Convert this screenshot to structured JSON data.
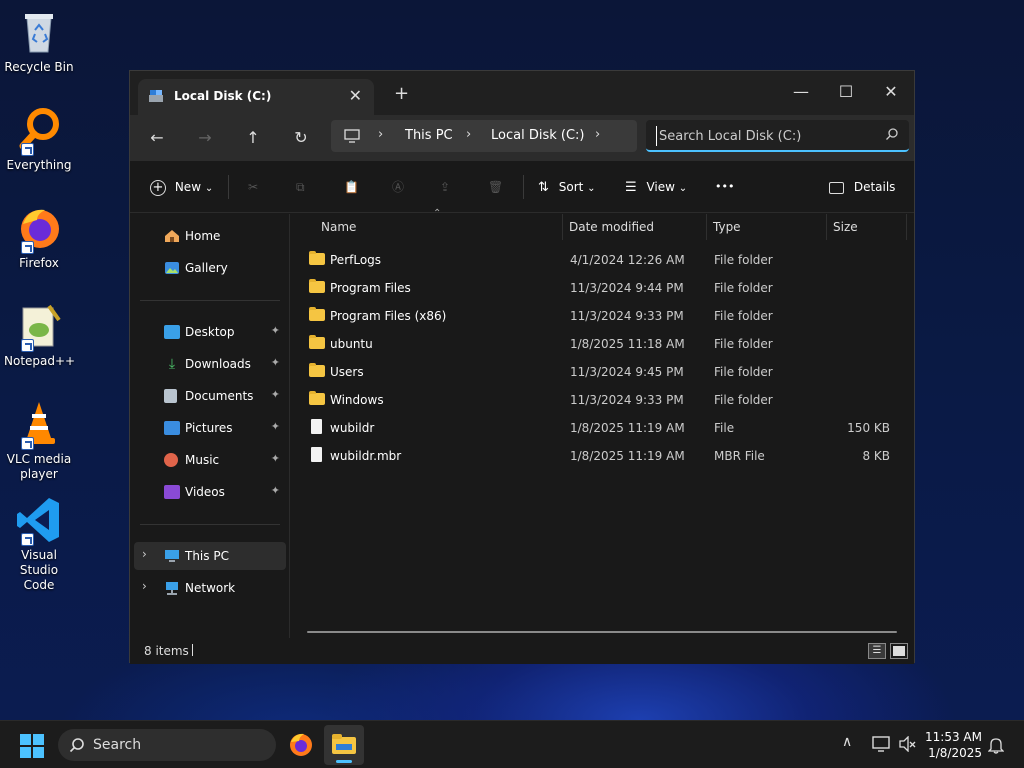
{
  "desktop": {
    "icons": [
      {
        "label": "Recycle Bin",
        "icon": "recycle-bin-icon"
      },
      {
        "label": "Everything",
        "icon": "everything-search-icon"
      },
      {
        "label": "Firefox",
        "icon": "firefox-icon"
      },
      {
        "label": "Notepad++",
        "icon": "notepad-plus-plus-icon"
      },
      {
        "label": "VLC media player",
        "icon": "vlc-icon"
      },
      {
        "label": "Visual Studio Code",
        "icon": "vscode-icon"
      }
    ]
  },
  "window": {
    "tab_title": "Local Disk (C:)",
    "tab_close": "✕",
    "new_tab": "+",
    "controls": {
      "minimize": "—",
      "maximize": "☐",
      "close": "✕"
    },
    "nav": {
      "back": "←",
      "forward": "→",
      "up": "↑",
      "refresh": "↻"
    },
    "address": {
      "segments": [
        "This PC",
        "Local Disk (C:)"
      ],
      "chevron": "›"
    },
    "search": {
      "placeholder": "Search Local Disk (C:)"
    },
    "toolbar": {
      "new": "New",
      "sort": "Sort",
      "view": "View",
      "more": "•••",
      "details": "Details",
      "dropdown": "⌄"
    },
    "sidebar": {
      "home": "Home",
      "gallery": "Gallery",
      "pinned": [
        {
          "label": "Desktop"
        },
        {
          "label": "Downloads"
        },
        {
          "label": "Documents"
        },
        {
          "label": "Pictures"
        },
        {
          "label": "Music"
        },
        {
          "label": "Videos"
        }
      ],
      "this_pc": "This PC",
      "network": "Network",
      "expander": "›",
      "pin_glyph": "📌"
    },
    "columns": {
      "name": "Name",
      "date": "Date modified",
      "type": "Type",
      "size": "Size"
    },
    "files": [
      {
        "name": "PerfLogs",
        "date": "4/1/2024 12:26 AM",
        "type": "File folder",
        "size": "",
        "kind": "folder"
      },
      {
        "name": "Program Files",
        "date": "11/3/2024 9:44 PM",
        "type": "File folder",
        "size": "",
        "kind": "folder"
      },
      {
        "name": "Program Files (x86)",
        "date": "11/3/2024 9:33 PM",
        "type": "File folder",
        "size": "",
        "kind": "folder"
      },
      {
        "name": "ubuntu",
        "date": "1/8/2025 11:18 AM",
        "type": "File folder",
        "size": "",
        "kind": "folder"
      },
      {
        "name": "Users",
        "date": "11/3/2024 9:45 PM",
        "type": "File folder",
        "size": "",
        "kind": "folder"
      },
      {
        "name": "Windows",
        "date": "11/3/2024 9:33 PM",
        "type": "File folder",
        "size": "",
        "kind": "folder"
      },
      {
        "name": "wubildr",
        "date": "1/8/2025 11:19 AM",
        "type": "File",
        "size": "150 KB",
        "kind": "file"
      },
      {
        "name": "wubildr.mbr",
        "date": "1/8/2025 11:19 AM",
        "type": "MBR File",
        "size": "8 KB",
        "kind": "file"
      }
    ],
    "status": {
      "count": "8 items"
    }
  },
  "taskbar": {
    "search_label": "Search",
    "time": "11:53 AM",
    "date": "1/8/2025",
    "tray_overflow": "∧"
  }
}
